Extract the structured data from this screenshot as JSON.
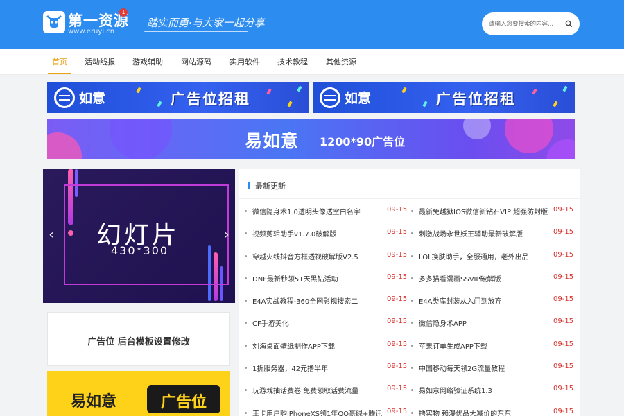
{
  "header": {
    "logo_title": "第一资源",
    "logo_badge": "1",
    "logo_domain": "www.eruyi.cn",
    "slogan": "踏实而勇·与大家一起分享",
    "search_placeholder": "请输入您要搜索的内容...",
    "brand_color": "#2c8cf0"
  },
  "nav": {
    "items": [
      {
        "label": "首页",
        "active": true
      },
      {
        "label": "活动线报"
      },
      {
        "label": "游戏辅助"
      },
      {
        "label": "网站源码"
      },
      {
        "label": "实用软件"
      },
      {
        "label": "技术教程"
      },
      {
        "label": "其他资源"
      }
    ],
    "active_color": "#e8a317"
  },
  "ads": {
    "small_brand": "如意",
    "small_main": "广告位招租",
    "wide_main": "易如意",
    "wide_sub": "1200*90广告位",
    "text_ad": "广告位 后台模板设置修改",
    "yellow_brand": "易如意",
    "yellow_tag": "广告位"
  },
  "slider": {
    "title": "幻灯片",
    "subtitle": "430*300",
    "prev_icon": "‹",
    "next_icon": "›"
  },
  "latest": {
    "heading": "最新更新",
    "left": [
      {
        "title": "微信隐身术1.0透明头像透空白名字",
        "date": "09-15"
      },
      {
        "title": "视频剪辑助手v1.7.0破解版",
        "date": "09-15"
      },
      {
        "title": "穿越火线抖音方框透视破解版V2.5",
        "date": "09-15"
      },
      {
        "title": "DNF最新秒领51天黑钻活动",
        "date": "09-15"
      },
      {
        "title": "E4A实战教程-360全网影视搜索二",
        "date": "09-15"
      },
      {
        "title": "CF手游美化",
        "date": "09-15"
      },
      {
        "title": "刘海桌面壁纸制作APP下载",
        "date": "09-15"
      },
      {
        "title": "1折服务器，42元撸半年",
        "date": "09-15"
      },
      {
        "title": "玩游戏抽话费卷 免费领取话费流量",
        "date": "09-15"
      },
      {
        "title": "王卡用户购iPhoneXS领1年QQ豪绿+腾讯",
        "date": "09-15"
      }
    ],
    "right": [
      {
        "title": "最新免越狱IOS微信新钻石VIP 超强防封版",
        "date": "09-15"
      },
      {
        "title": "刺激战场永世妖王辅助最新破解版",
        "date": "09-15"
      },
      {
        "title": "LOL换肤助手，全服通用，老外出品",
        "date": "09-15"
      },
      {
        "title": "多多猫看漫画SSVIP破解版",
        "date": "09-15"
      },
      {
        "title": "E4A类库封装从入门到放弃",
        "date": "09-15"
      },
      {
        "title": "微信隐身术APP",
        "date": "09-15"
      },
      {
        "title": "苹果订单生成APP下载",
        "date": "09-15"
      },
      {
        "title": "中国移动每天领2G流量教程",
        "date": "09-15"
      },
      {
        "title": "易如意网络验证系统1.3",
        "date": "09-15"
      },
      {
        "title": "撸实物 赖漫优品大减价的东东",
        "date": "09-15"
      }
    ],
    "date_color": "#d9302c"
  }
}
